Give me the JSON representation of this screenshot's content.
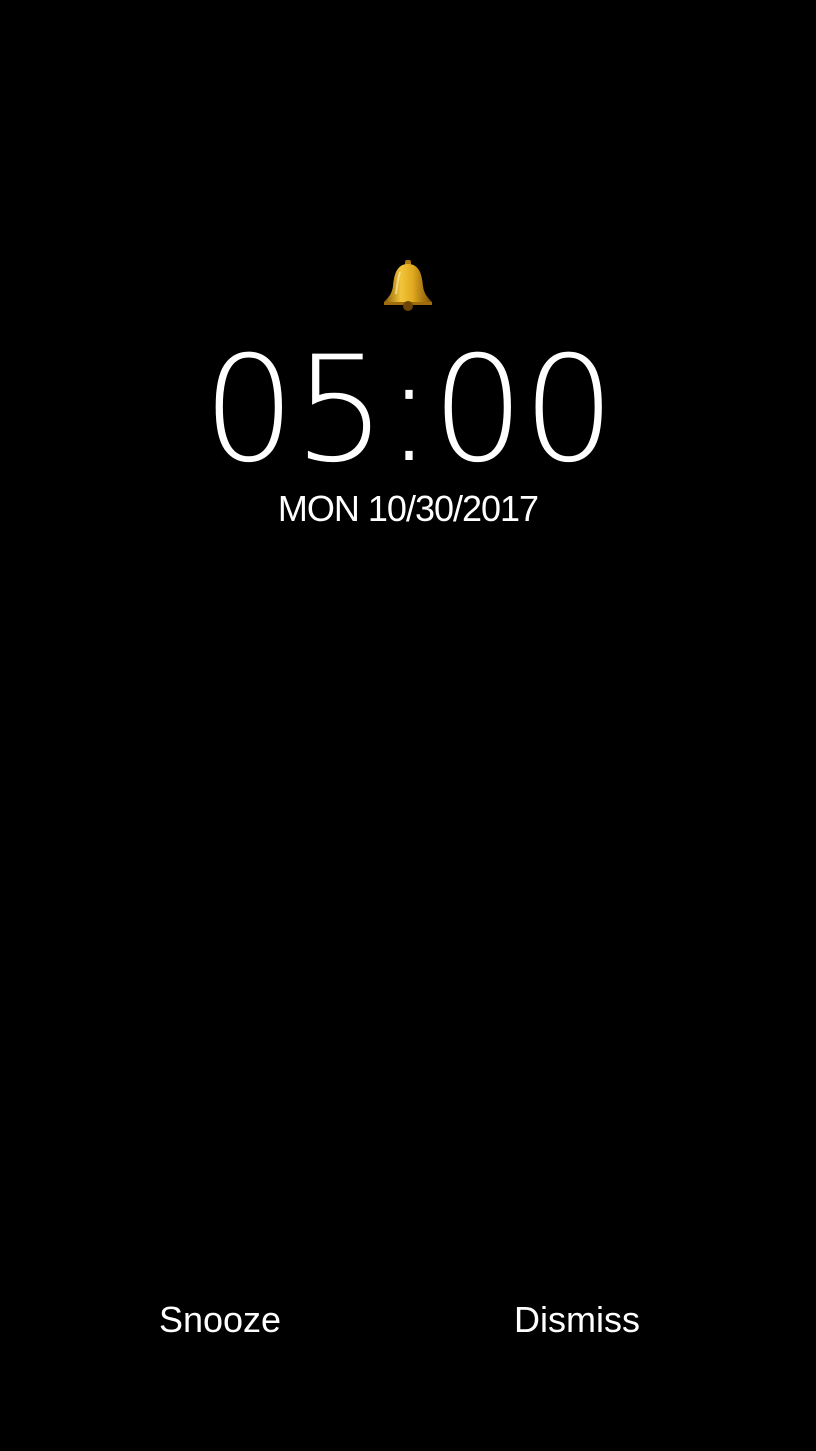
{
  "alarm": {
    "icon": "bell-icon",
    "time": "05:00",
    "date": "MON 10/30/2017"
  },
  "actions": {
    "snooze_label": "Snooze",
    "dismiss_label": "Dismiss"
  },
  "colors": {
    "background": "#000000",
    "text": "#ffffff",
    "bell_gold": "#d9a21b"
  }
}
